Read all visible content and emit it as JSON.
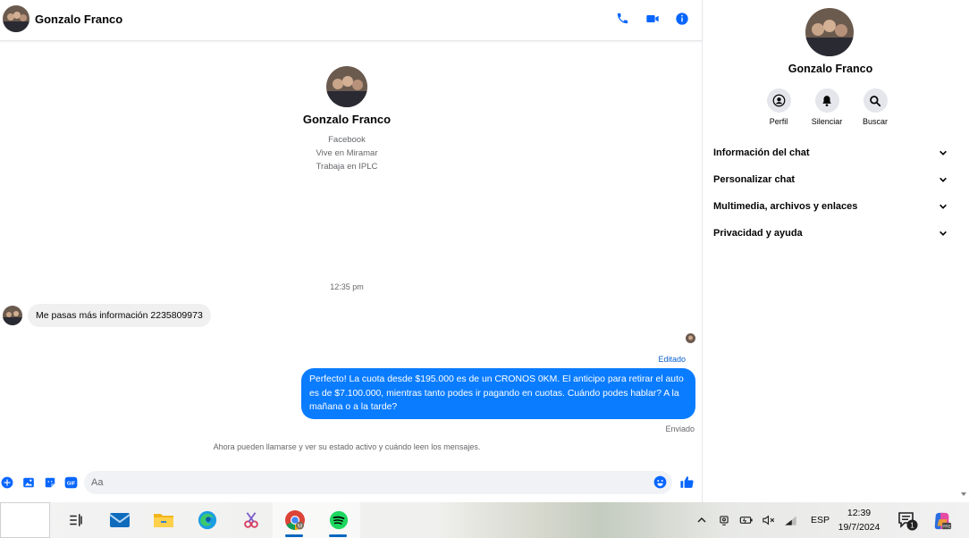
{
  "contact": {
    "name": "Gonzalo Franco",
    "details": [
      "Facebook",
      "Vive en Miramar",
      "Trabaja en IPLC"
    ]
  },
  "conversation": {
    "timestamp": "12:35 pm",
    "incoming": "Me pasas más información 2235809973",
    "edited_label": "Editado",
    "outgoing": "Perfecto! La cuota desde $195.000 es de un CRONOS 0KM. El anticipo para retirar el auto es de $7.100.000, mientras tanto podes ir pagando en cuotas. Cuándo podes hablar? A la mañana o a la tarde?",
    "sent_label": "Enviado",
    "notice": "Ahora pueden llamarse y ver su estado activo y cuándo leen los mensajes."
  },
  "composer": {
    "placeholder": "Aa",
    "gif_label": "GIF"
  },
  "info_panel": {
    "actions": [
      "Perfil",
      "Silenciar",
      "Buscar"
    ],
    "sections": [
      "Información del chat",
      "Personalizar chat",
      "Multimedia, archivos y enlaces",
      "Privacidad y ayuda"
    ]
  },
  "taskbar": {
    "apps": [
      "task-view",
      "mail",
      "file-explorer",
      "edge",
      "snipping-tool",
      "chrome",
      "spotify"
    ],
    "language": "ESP",
    "time": "12:39",
    "date": "19/7/2024",
    "notification_count": "1"
  },
  "colors": {
    "accent": "#0a7cff",
    "icon_blue": "#0866ff",
    "bubble_in": "#f0f0f0"
  }
}
